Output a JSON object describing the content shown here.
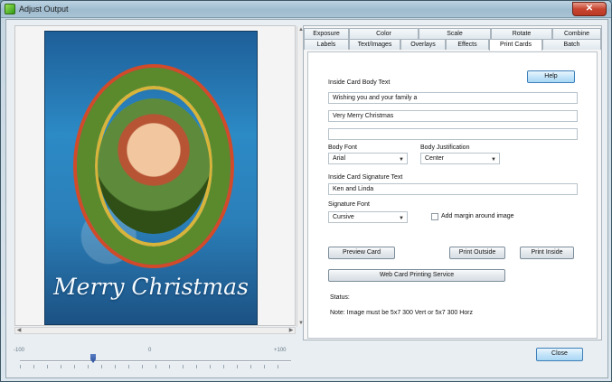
{
  "window": {
    "title": "Adjust Output",
    "close_glyph": "✕"
  },
  "preview": {
    "card_greeting": "Merry Christmas"
  },
  "slider": {
    "min_label": "-100",
    "mid_label": "0",
    "max_label": "+100",
    "value": -50
  },
  "tabs": {
    "row1": [
      "Exposure",
      "Color",
      "Scale",
      "Rotate",
      "Combine"
    ],
    "row2": [
      "Labels",
      "Text/Images",
      "Overlays",
      "Effects",
      "Print Cards",
      "Batch"
    ],
    "active": "Print Cards"
  },
  "print_cards": {
    "help_label": "Help",
    "body_text_label": "Inside Card Body Text",
    "body_lines": [
      "Wishing you and your family a",
      "Very Merry Christmas",
      ""
    ],
    "body_font_label": "Body Font",
    "body_font_value": "Arial",
    "body_justification_label": "Body Justification",
    "body_justification_value": "Center",
    "signature_text_label": "Inside Card Signature Text",
    "signature_value": "Ken and Linda",
    "signature_font_label": "Signature Font",
    "signature_font_value": "Cursive",
    "margin_checkbox_label": "Add margin around image",
    "margin_checked": false,
    "preview_button": "Preview Card",
    "print_outside_button": "Print Outside",
    "print_inside_button": "Print Inside",
    "web_service_button": "Web Card Printing Service",
    "status_label": "Status:",
    "note": "Note: Image must be 5x7 300 Vert or 5x7 300 Horz"
  },
  "footer": {
    "close_label": "Close"
  },
  "colors": {
    "accent": "#3d7fb8",
    "close_red": "#c74530",
    "panel_bg": "#f6f6f6"
  }
}
